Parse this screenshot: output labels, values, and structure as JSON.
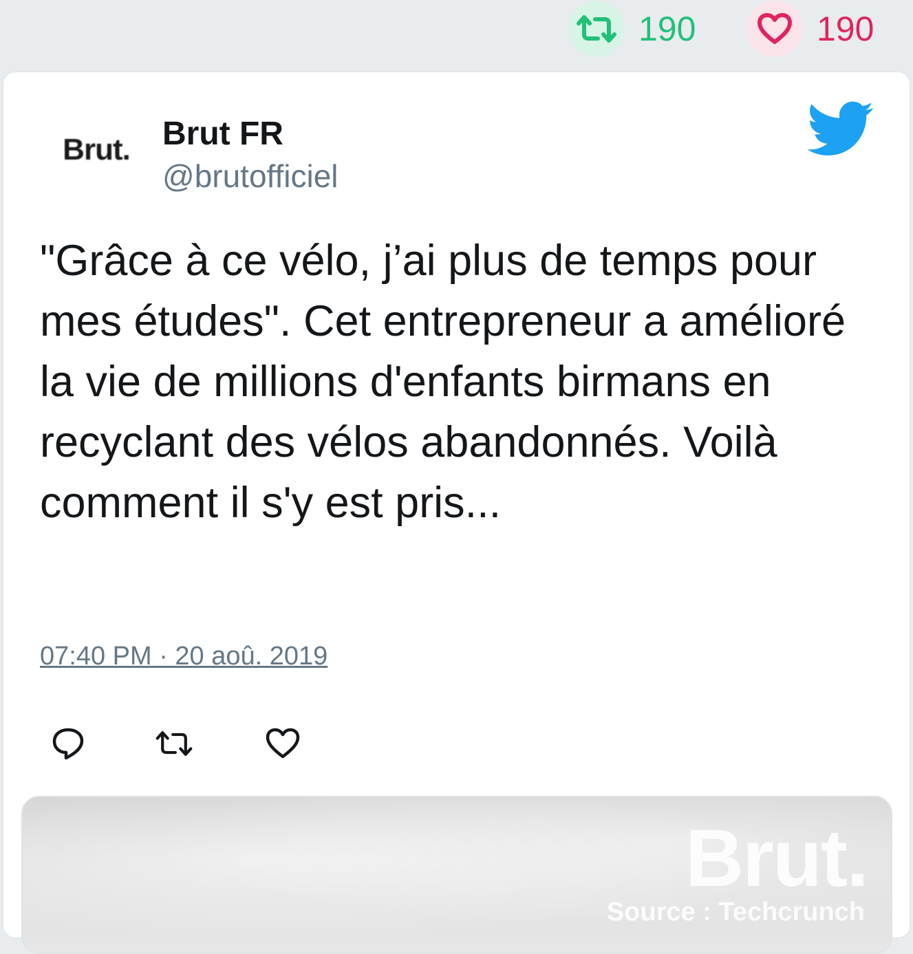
{
  "top_stats": {
    "retweets": "190",
    "likes": "190"
  },
  "tweet": {
    "author_name": "Brut FR",
    "author_handle": "@brutofficiel",
    "avatar_text": "Brut.",
    "text": "\"Grâce à ce vélo, j’ai plus de temps pour mes études\". Cet entrepreneur a amélioré la vie de millions d'enfants birmans en recyclant des vélos abandonnés. Voilà comment il s'y est pris...",
    "timestamp": "07:40 PM · 20 aoû. 2019"
  },
  "media": {
    "logo_text": "Brut.",
    "source_text": "Source : Techcrunch"
  },
  "icons": {
    "retweet": "retweet-icon",
    "like": "heart-icon",
    "reply": "reply-icon",
    "brand": "twitter-bird-icon"
  },
  "colors": {
    "retweet_green": "#22c079",
    "like_red": "#e0245e",
    "twitter_blue": "#1da1f2",
    "muted_gray": "#657786"
  }
}
